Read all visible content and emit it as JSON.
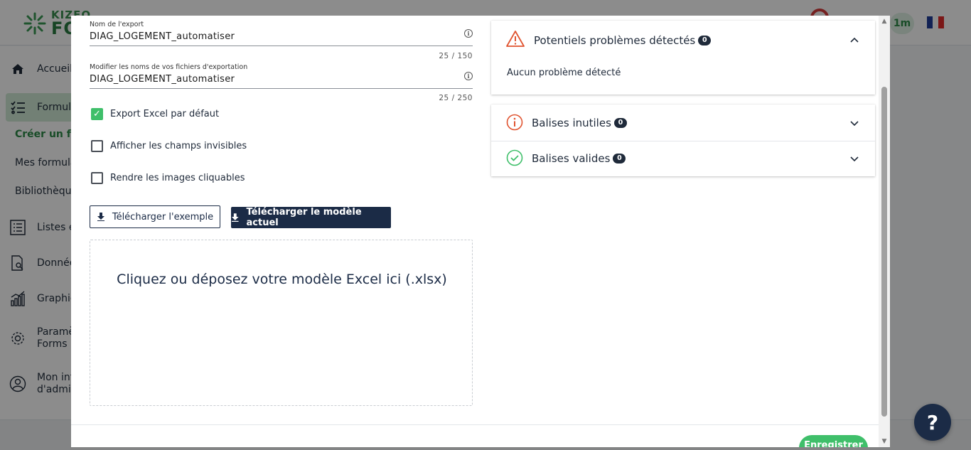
{
  "background": {
    "logo": {
      "small": "KIZEO",
      "big": "FO"
    },
    "time_badge": "1m",
    "nav": [
      {
        "label": "Accueil",
        "icon": "home-icon"
      },
      {
        "label": "Formul",
        "icon": "forms-list-icon"
      },
      {
        "label": "Listes e",
        "icon": "list-icon"
      },
      {
        "label": "Donnée",
        "icon": "data-search-icon"
      },
      {
        "label": "Graphic",
        "icon": "chart-icon"
      },
      {
        "label": "Paramè",
        "label2": "Forms",
        "icon": "settings-icon"
      },
      {
        "label": "Mon int",
        "label2": "d'admin",
        "icon": "user-icon"
      }
    ],
    "sub_nav": [
      {
        "label": "Créer un for",
        "active": true
      },
      {
        "label": "Mes formula",
        "active": false
      },
      {
        "label": "Bibliothèque",
        "active": false
      }
    ]
  },
  "form": {
    "export_name": {
      "label": "Nom de l'export",
      "value": "DIAG_LOGEMENT_automatiser",
      "counter": "25 / 150"
    },
    "file_names": {
      "label": "Modifier les noms de vos fichiers d'exportation",
      "value": "DIAG_LOGEMENT_automatiser",
      "counter": "25 / 250"
    },
    "checkboxes": [
      {
        "label": "Export Excel par défaut",
        "checked": true
      },
      {
        "label": "Afficher les champs invisibles",
        "checked": false
      },
      {
        "label": "Rendre les images cliquables",
        "checked": false
      }
    ],
    "download_example_label": "Télécharger l'exemple",
    "download_current_label": "Télécharger le modèle actuel",
    "dropzone_text": "Cliquez ou déposez votre modèle Excel ici (.xlsx)"
  },
  "panels": {
    "problems": {
      "title": "Potentiels problèmes détectés",
      "count": "0",
      "body": "Aucun problème détecté",
      "color": "#e0532f"
    },
    "useless": {
      "title": "Balises inutiles",
      "count": "0",
      "color": "#e0532f"
    },
    "valid": {
      "title": "Balises valides",
      "count": "0",
      "color": "#3fbf6a"
    }
  },
  "footer": {
    "save_label": "Enregistrer"
  },
  "help": {
    "label": "?"
  },
  "colors": {
    "accent": "#3fbf6a",
    "navy": "#1b2b46",
    "warning": "#e0532f"
  }
}
